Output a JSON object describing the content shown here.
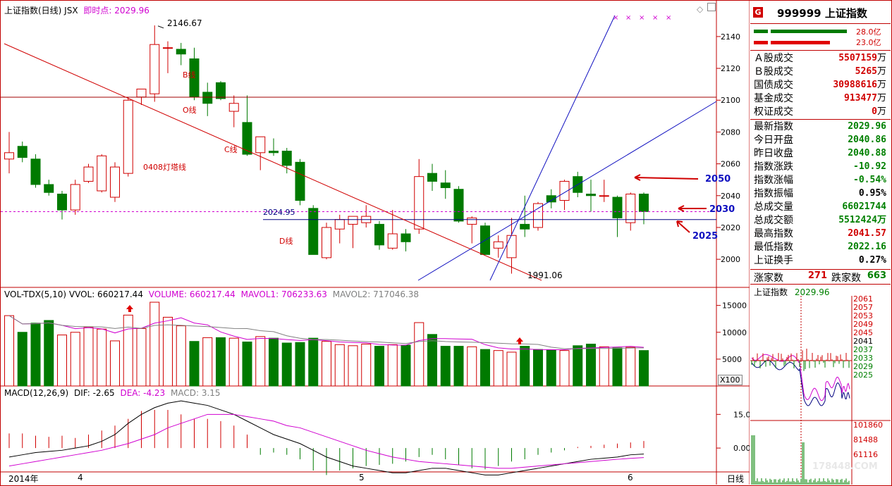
{
  "main_chart": {
    "title": "上证指数(日线) JSX",
    "realtime_label": "即时点:",
    "realtime_value": "2029.96",
    "annotations": {
      "peak": "2146.67",
      "trough": "1991.06",
      "line_b": "B线",
      "line_o": "O线",
      "line_c": "C线",
      "line_d": "D线",
      "lighthouse": "0408灯塔线",
      "level": "2024.95",
      "target_2050": "2050",
      "target_2030": "2030",
      "target_2025": "2025"
    },
    "y_ticks": [
      "2140",
      "2120",
      "2100",
      "2080",
      "2060",
      "2040",
      "2020",
      "2000"
    ]
  },
  "volume_chart": {
    "title": "VOL-TDX(5,10)",
    "vvol_label": "VVOL: 660217.44",
    "volume_label": "VOLUME: 660217.44",
    "mavol1_label": "MAVOL1: 706233.63",
    "mavol2_label": "MAVOL2: 717046.38",
    "y_ticks": [
      "15000",
      "10000",
      "5000"
    ],
    "unit": "X100"
  },
  "macd_chart": {
    "title": "MACD(12,26,9)",
    "dif_label": "DIF: -2.65",
    "dea_label": "DEA: -4.23",
    "macd_label": "MACD: 3.15",
    "y_ticks": [
      "15.00",
      "0.00"
    ]
  },
  "x_axis": {
    "labels": [
      "2014年",
      "4",
      "5",
      "6"
    ],
    "period": "日线"
  },
  "right_panel": {
    "badge": "G",
    "code": "999999",
    "name": "上证指数",
    "bar_top_value": "28.0亿",
    "bar_bottom_value": "23.0亿",
    "turnover_rows": [
      {
        "label": "Ａ股成交",
        "value": "5507159",
        "unit": "万"
      },
      {
        "label": "Ｂ股成交",
        "value": "5265",
        "unit": "万"
      },
      {
        "label": "国债成交",
        "value": "30988616",
        "unit": "万"
      },
      {
        "label": "基金成交",
        "value": "913477",
        "unit": "万"
      },
      {
        "label": "权证成交",
        "value": "0",
        "unit": "万"
      }
    ],
    "index_rows": [
      {
        "label": "最新指数",
        "value": "2029.96",
        "color": "#008000"
      },
      {
        "label": "今日开盘",
        "value": "2040.86",
        "color": "#008000"
      },
      {
        "label": "昨日收盘",
        "value": "2040.88",
        "color": "#008000"
      },
      {
        "label": "指数涨跌",
        "value": "-10.92",
        "color": "#008000"
      },
      {
        "label": "指数涨幅",
        "value": "-0.54%",
        "color": "#008000"
      },
      {
        "label": "指数振幅",
        "value": "0.95%",
        "color": "#000000"
      },
      {
        "label": "总成交量",
        "value": "66021744",
        "color": "#008000"
      },
      {
        "label": "总成交额",
        "value": "5512424万",
        "color": "#008000"
      },
      {
        "label": "最高指数",
        "value": "2041.57",
        "color": "#d00000"
      },
      {
        "label": "最低指数",
        "value": "2022.16",
        "color": "#008000"
      },
      {
        "label": "上证换手",
        "value": "0.27%",
        "color": "#000000"
      }
    ],
    "up_label": "涨家数",
    "up_count": "271",
    "down_label": "跌家数",
    "down_count": "663",
    "mini_title": "上证指数",
    "mini_value": "2029.96",
    "mini_ticks": [
      "2061",
      "2057",
      "2053",
      "2049",
      "2045",
      "2041",
      "2037",
      "2033",
      "2029",
      "2025",
      "101860",
      "81488",
      "61116"
    ]
  },
  "watermark": "178448.COM",
  "colors": {
    "up": "#d00000",
    "down": "#007a00",
    "frame": "#c00000"
  },
  "chart_data": {
    "type": "candlestick",
    "ohlc": [
      {
        "o": 2063,
        "h": 2080,
        "l": 2054,
        "c": 2067
      },
      {
        "o": 2071,
        "h": 2074,
        "l": 2061,
        "c": 2064
      },
      {
        "o": 2063,
        "h": 2066,
        "l": 2045,
        "c": 2047
      },
      {
        "o": 2047,
        "h": 2050,
        "l": 2040,
        "c": 2042
      },
      {
        "o": 2041,
        "h": 2043,
        "l": 2025,
        "c": 2031
      },
      {
        "o": 2031,
        "h": 2050,
        "l": 2028,
        "c": 2047
      },
      {
        "o": 2049,
        "h": 2060,
        "l": 2048,
        "c": 2058
      },
      {
        "o": 2043,
        "h": 2066,
        "l": 2042,
        "c": 2065
      },
      {
        "o": 2039,
        "h": 2061,
        "l": 2036,
        "c": 2058
      },
      {
        "o": 2054,
        "h": 2102,
        "l": 2052,
        "c": 2100
      },
      {
        "o": 2102,
        "h": 2107,
        "l": 2097,
        "c": 2107
      },
      {
        "o": 2104,
        "h": 2147,
        "l": 2099,
        "c": 2135
      },
      {
        "o": 2133,
        "h": 2137,
        "l": 2117,
        "c": 2133
      },
      {
        "o": 2132,
        "h": 2136,
        "l": 2122,
        "c": 2129
      },
      {
        "o": 2126,
        "h": 2133,
        "l": 2100,
        "c": 2102
      },
      {
        "o": 2105,
        "h": 2111,
        "l": 2090,
        "c": 2098
      },
      {
        "o": 2111,
        "h": 2112,
        "l": 2100,
        "c": 2101
      },
      {
        "o": 2093,
        "h": 2103,
        "l": 2083,
        "c": 2098
      },
      {
        "o": 2086,
        "h": 2103,
        "l": 2065,
        "c": 2066
      },
      {
        "o": 2067,
        "h": 2076,
        "l": 2056,
        "c": 2077
      },
      {
        "o": 2068,
        "h": 2076,
        "l": 2065,
        "c": 2067
      },
      {
        "o": 2068,
        "h": 2070,
        "l": 2054,
        "c": 2059
      },
      {
        "o": 2061,
        "h": 2063,
        "l": 2034,
        "c": 2037
      },
      {
        "o": 2032,
        "h": 2034,
        "l": 2003,
        "c": 2003
      },
      {
        "o": 2001,
        "h": 2023,
        "l": 2000,
        "c": 2020
      },
      {
        "o": 2019,
        "h": 2028,
        "l": 2010,
        "c": 2025
      },
      {
        "o": 2022,
        "h": 2027,
        "l": 2007,
        "c": 2027
      },
      {
        "o": 2023,
        "h": 2034,
        "l": 2020,
        "c": 2027
      },
      {
        "o": 2022,
        "h": 2024,
        "l": 2006,
        "c": 2009
      },
      {
        "o": 2007,
        "h": 2031,
        "l": 2006,
        "c": 2016
      },
      {
        "o": 2016,
        "h": 2019,
        "l": 2005,
        "c": 2011
      },
      {
        "o": 2019,
        "h": 2063,
        "l": 2016,
        "c": 2052
      },
      {
        "o": 2054,
        "h": 2060,
        "l": 2043,
        "c": 2049
      },
      {
        "o": 2048,
        "h": 2056,
        "l": 2038,
        "c": 2045
      },
      {
        "o": 2044,
        "h": 2046,
        "l": 2023,
        "c": 2024
      },
      {
        "o": 2022,
        "h": 2027,
        "l": 2010,
        "c": 2026
      },
      {
        "o": 2021,
        "h": 2023,
        "l": 2003,
        "c": 2003
      },
      {
        "o": 2007,
        "h": 2015,
        "l": 2001,
        "c": 2011
      },
      {
        "o": 2001,
        "h": 2026,
        "l": 1991,
        "c": 2015
      },
      {
        "o": 2022,
        "h": 2040,
        "l": 2014,
        "c": 2019
      },
      {
        "o": 2020,
        "h": 2036,
        "l": 2018,
        "c": 2035
      },
      {
        "o": 2040,
        "h": 2044,
        "l": 2032,
        "c": 2036
      },
      {
        "o": 2037,
        "h": 2050,
        "l": 2031,
        "c": 2049
      },
      {
        "o": 2052,
        "h": 2055,
        "l": 2039,
        "c": 2042
      },
      {
        "o": 2041,
        "h": 2050,
        "l": 2030,
        "c": 2040
      },
      {
        "o": 2040,
        "h": 2050,
        "l": 2036,
        "c": 2040
      },
      {
        "o": 2039,
        "h": 2040,
        "l": 2014,
        "c": 2026
      },
      {
        "o": 2023,
        "h": 2042,
        "l": 2018,
        "c": 2041
      },
      {
        "o": 2041,
        "h": 2042,
        "l": 2022,
        "c": 2030
      }
    ],
    "volume": [
      13100,
      10000,
      11700,
      12200,
      9500,
      10000,
      10900,
      10600,
      8400,
      13200,
      10700,
      15600,
      12800,
      11200,
      8300,
      9000,
      9000,
      8900,
      8200,
      9200,
      8900,
      8000,
      8100,
      8900,
      8300,
      7700,
      7500,
      7800,
      7400,
      7700,
      7600,
      11800,
      9600,
      7400,
      7400,
      7300,
      6800,
      6600,
      6300,
      7400,
      6800,
      6700,
      6600,
      7500,
      7800,
      7300,
      7100,
      7200,
      6600
    ],
    "vol_up": [
      1,
      0,
      0,
      0,
      1,
      1,
      1,
      1,
      1,
      1,
      1,
      1,
      1,
      1,
      0,
      1,
      0,
      1,
      0,
      1,
      0,
      0,
      0,
      0,
      1,
      1,
      1,
      1,
      0,
      1,
      0,
      1,
      0,
      0,
      0,
      1,
      0,
      1,
      1,
      0,
      0,
      0,
      1,
      0,
      0,
      1,
      0,
      1,
      0
    ],
    "macd_hist": [
      6.5,
      6.5,
      5.5,
      5,
      5.5,
      4.5,
      6,
      7.8,
      10,
      13,
      16.5,
      17,
      17,
      15,
      13,
      13,
      12,
      10,
      6,
      -3,
      -2,
      -3,
      -5,
      -10,
      -12,
      -10,
      -9,
      -8,
      -7.5,
      -7,
      -6,
      -4,
      -3,
      -5,
      -7.5,
      -9,
      -9.5,
      -8,
      -6,
      -5,
      -3,
      -2,
      -1,
      0.5,
      1,
      1.5,
      2,
      2.5,
      3.15
    ],
    "dif": [
      -4,
      -3,
      -2,
      -1.5,
      -1,
      0,
      1,
      3,
      6,
      11,
      15,
      18,
      20,
      21,
      20,
      19,
      17,
      15,
      12,
      9,
      6,
      4,
      2,
      -1,
      -4,
      -6,
      -8,
      -9,
      -10,
      -11,
      -11,
      -10,
      -9,
      -9,
      -10,
      -11,
      -12,
      -12,
      -11,
      -10,
      -9,
      -8,
      -7,
      -6,
      -5,
      -4.5,
      -4,
      -3,
      -2.65
    ],
    "dea": [
      -8,
      -7,
      -6,
      -5,
      -4,
      -3,
      -2,
      -1,
      0.5,
      2,
      4,
      6,
      9,
      11,
      13,
      15,
      15,
      15,
      14,
      13,
      12,
      10,
      9,
      7,
      5,
      3,
      1,
      -1,
      -2.5,
      -4,
      -5,
      -6,
      -6.5,
      -7,
      -7.5,
      -8,
      -8.5,
      -9,
      -9,
      -8.5,
      -8,
      -7.5,
      -7,
      -6.5,
      -6,
      -5.5,
      -5,
      -4.6,
      -4.23
    ],
    "y_range": [
      1985,
      2155
    ],
    "vol_range": [
      0,
      16000
    ],
    "macd_range": [
      -10,
      22
    ]
  }
}
